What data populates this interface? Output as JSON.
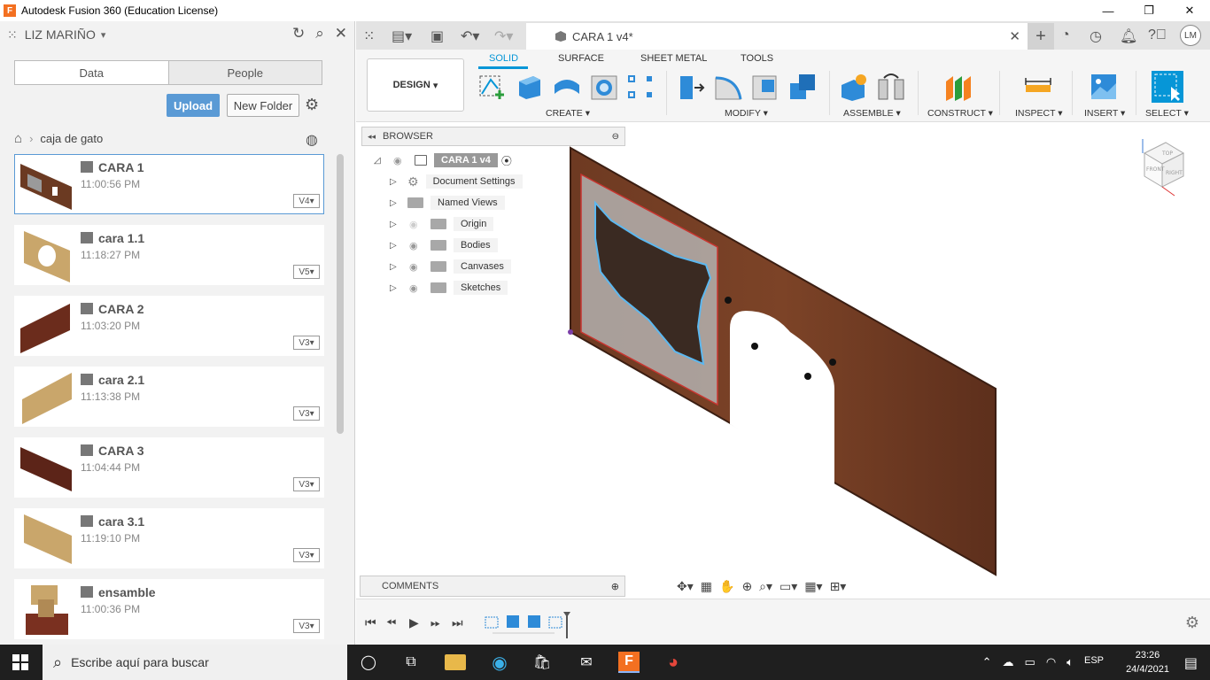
{
  "titlebar": {
    "title": "Autodesk Fusion 360 (Education License)"
  },
  "datapanel": {
    "user": "LIZ MARIÑO",
    "tabs": [
      "Data",
      "People"
    ],
    "upload_label": "Upload",
    "new_folder_label": "New Folder",
    "breadcrumb": "caja de gato",
    "files": [
      {
        "name": "CARA 1",
        "time": "11:00:56 PM",
        "version": "V4"
      },
      {
        "name": "cara 1.1",
        "time": "11:18:27 PM",
        "version": "V5"
      },
      {
        "name": "CARA 2",
        "time": "11:03:20 PM",
        "version": "V3"
      },
      {
        "name": "cara 2.1",
        "time": "11:13:38 PM",
        "version": "V3"
      },
      {
        "name": "CARA 3",
        "time": "11:04:44 PM",
        "version": "V3"
      },
      {
        "name": "cara 3.1",
        "time": "11:19:10 PM",
        "version": "V3"
      },
      {
        "name": "ensamble",
        "time": "11:00:36 PM",
        "version": "V3"
      }
    ]
  },
  "tabsbar": {
    "doc_tab": "CARA 1 v4*",
    "avatar": "LM"
  },
  "toolbar": {
    "workspace": "DESIGN",
    "modes": [
      "SOLID",
      "SURFACE",
      "SHEET METAL",
      "TOOLS"
    ],
    "groups": [
      "CREATE",
      "MODIFY",
      "ASSEMBLE",
      "CONSTRUCT",
      "INSPECT",
      "INSERT",
      "SELECT"
    ]
  },
  "browser": {
    "title": "BROWSER",
    "root": "CARA 1 v4",
    "items": [
      "Document Settings",
      "Named Views",
      "Origin",
      "Bodies",
      "Canvases",
      "Sketches"
    ]
  },
  "comments": {
    "title": "COMMENTS"
  },
  "viewcube": {
    "top": "TOP",
    "front": "FRONT",
    "right": "RIGHT"
  },
  "taskbar": {
    "search_placeholder": "Escribe aquí para buscar",
    "lang": "ESP",
    "time": "23:26",
    "date": "24/4/2021"
  }
}
